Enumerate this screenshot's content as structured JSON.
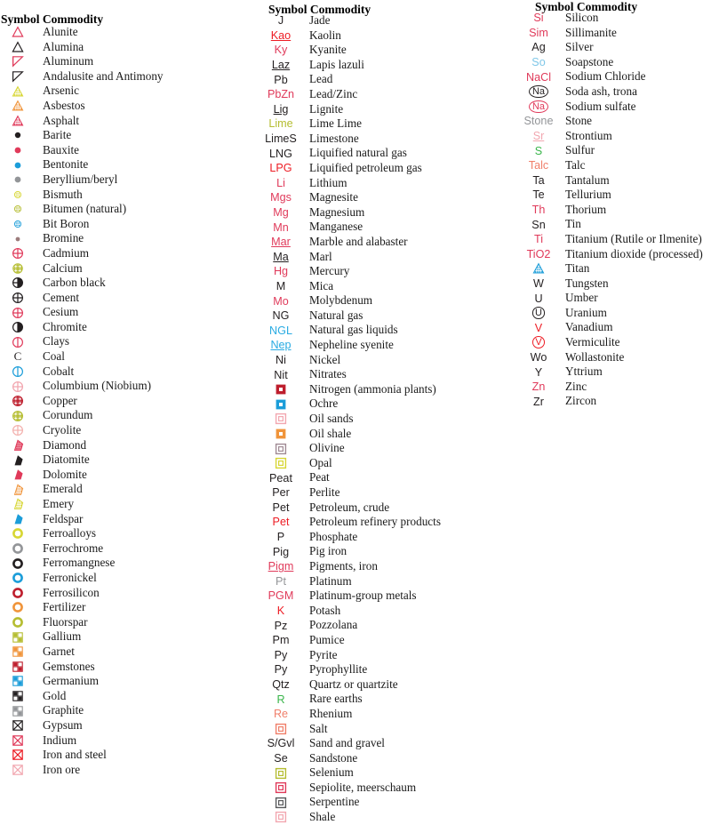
{
  "headers": {
    "symbol": "Symbol",
    "commodity": "Commodity",
    "full": "Symbol Commodity"
  },
  "colors": {
    "black": "#231f20",
    "crimson": "#e03a5a",
    "red": "#ed1c24",
    "blue": "#1b9dd9",
    "cyan": "#29abe2",
    "gray": "#939598",
    "yellow": "#d7d633",
    "olive": "#b5bd31",
    "orange": "#f0943a",
    "pink": "#f2a7b0",
    "darkred": "#be1e2d",
    "green": "#39b54a",
    "salmon": "#f07f6a",
    "tan": "#d9a066",
    "lightblue": "#7fc7e8"
  },
  "columns": [
    {
      "id": "column-1",
      "rows": [
        {
          "symbol": "triangle-outline-crimson",
          "label": "Alunite"
        },
        {
          "symbol": "triangle-outline-black",
          "label": "Alumina"
        },
        {
          "symbol": "flag-triangle-crimson",
          "label": "Aluminum"
        },
        {
          "symbol": "flag-triangle-black",
          "label": "Andalusite and Antimony"
        },
        {
          "symbol": "triangle-dotted-yellow",
          "label": "Arsenic"
        },
        {
          "symbol": "triangle-dotted-orange",
          "label": "Asbestos"
        },
        {
          "symbol": "triangle-dotted-crimson",
          "label": "Asphalt"
        },
        {
          "symbol": "dot-black",
          "label": "Barite"
        },
        {
          "symbol": "dot-crimson",
          "label": "Bauxite"
        },
        {
          "symbol": "dot-blue",
          "label": "Bentonite"
        },
        {
          "symbol": "dot-gray",
          "label": "Beryllium/beryl"
        },
        {
          "symbol": "dot-dotted-yellow",
          "label": "Bismuth"
        },
        {
          "symbol": "dot-dotted-olive",
          "label": "Bitumen (natural)"
        },
        {
          "symbol": "dot-dotted-blue",
          "label": "Bit Boron"
        },
        {
          "symbol": "dot-small-mauve",
          "label": "Bromine"
        },
        {
          "symbol": "circle-cross-crimson",
          "label": "Cadmium"
        },
        {
          "symbol": "circle-cross-dotted-olive",
          "label": "Calcium"
        },
        {
          "symbol": "circle-half-black",
          "label": "Carbon black"
        },
        {
          "symbol": "circle-cross-black",
          "label": "Cement"
        },
        {
          "symbol": "circle-cross-crimson2",
          "label": "Cesium"
        },
        {
          "symbol": "circle-vhalf-black",
          "label": "Chromite"
        },
        {
          "symbol": "circle-vhalf-crimson",
          "label": "Clays"
        },
        {
          "symbol": "letter-C",
          "label": "Coal"
        },
        {
          "symbol": "circle-vhalf-blue",
          "label": "Cobalt"
        },
        {
          "symbol": "circle-cross-pink",
          "label": "Columbium (Niobium)"
        },
        {
          "symbol": "circle-cross-darkred",
          "label": "Copper"
        },
        {
          "symbol": "circle-cross-olive",
          "label": "Corundum"
        },
        {
          "symbol": "circle-cross-pink2",
          "label": "Cryolite"
        },
        {
          "symbol": "pentagon-dotted-crimson",
          "label": "Diamond"
        },
        {
          "symbol": "pentagon-black",
          "label": "Diatomite"
        },
        {
          "symbol": "pentagon-crimson",
          "label": "Dolomite"
        },
        {
          "symbol": "pentagon-dotted-orange",
          "label": "Emerald"
        },
        {
          "symbol": "pentagon-dotted-yellow",
          "label": "Emery"
        },
        {
          "symbol": "pentagon-blue",
          "label": "Feldspar"
        },
        {
          "symbol": "donut-yellow",
          "label": "Ferroalloys"
        },
        {
          "symbol": "donut-gray",
          "label": "Ferrochrome"
        },
        {
          "symbol": "donut-black",
          "label": "Ferromangnese"
        },
        {
          "symbol": "donut-blue",
          "label": "Ferronickel"
        },
        {
          "symbol": "donut-crimson",
          "label": "Ferrosilicon"
        },
        {
          "symbol": "donut-orange",
          "label": "Fertilizer"
        },
        {
          "symbol": "donut-olive",
          "label": "Fluorspar"
        },
        {
          "symbol": "quad-square-olive",
          "label": "Gallium"
        },
        {
          "symbol": "quad-square-orange",
          "label": "Garnet"
        },
        {
          "symbol": "quad-square-crimson",
          "label": "Gemstones"
        },
        {
          "symbol": "quad-square-blue",
          "label": "Germanium"
        },
        {
          "symbol": "quad-square-black",
          "label": "Gold"
        },
        {
          "symbol": "quad-square-gray",
          "label": "Graphite"
        },
        {
          "symbol": "xsquare-black",
          "label": "Gypsum"
        },
        {
          "symbol": "xsquare-crimson",
          "label": "Indium"
        },
        {
          "symbol": "xsquare-red",
          "label": "Iron and steel"
        },
        {
          "symbol": "xsquare-pink",
          "label": "Iron ore"
        }
      ]
    },
    {
      "id": "column-2",
      "rows": [
        {
          "symbol": "text",
          "text": "J",
          "color": "black",
          "label": "Jade"
        },
        {
          "symbol": "text",
          "text": "Kao",
          "color": "red",
          "underline": true,
          "label": "Kaolin"
        },
        {
          "symbol": "text",
          "text": "Ky",
          "color": "crimson",
          "label": "Kyanite"
        },
        {
          "symbol": "text",
          "text": "Laz",
          "color": "black",
          "underline": true,
          "label": "Lapis lazuli"
        },
        {
          "symbol": "text",
          "text": "Pb",
          "color": "black",
          "label": "Lead"
        },
        {
          "symbol": "text",
          "text": "PbZn",
          "color": "crimson",
          "label": "Lead/Zinc"
        },
        {
          "symbol": "text",
          "text": "Lig",
          "color": "black",
          "underline": true,
          "label": "Lignite"
        },
        {
          "symbol": "text",
          "text": "Lime",
          "color": "olive",
          "label": "Lime Lime"
        },
        {
          "symbol": "text",
          "text": "LimeS",
          "color": "black",
          "label": "Limestone"
        },
        {
          "symbol": "text",
          "text": "LNG",
          "color": "black",
          "label": "Liquified natural gas"
        },
        {
          "symbol": "text",
          "text": "LPG",
          "color": "red",
          "label": "Liquified petroleum gas"
        },
        {
          "symbol": "text",
          "text": "Li",
          "color": "crimson",
          "label": "Lithium"
        },
        {
          "symbol": "text",
          "text": "Mgs",
          "color": "crimson",
          "label": "Magnesite"
        },
        {
          "symbol": "text",
          "text": "Mg",
          "color": "crimson",
          "label": "Magnesium"
        },
        {
          "symbol": "text",
          "text": "Mn",
          "color": "crimson",
          "label": "Manganese"
        },
        {
          "symbol": "text",
          "text": "Mar",
          "color": "crimson",
          "underline": true,
          "label": "Marble and alabaster"
        },
        {
          "symbol": "text",
          "text": "Ma",
          "color": "black",
          "underline": true,
          "label": "Marl"
        },
        {
          "symbol": "text",
          "text": "Hg",
          "color": "crimson",
          "label": "Mercury"
        },
        {
          "symbol": "text",
          "text": "M",
          "color": "black",
          "label": "Mica"
        },
        {
          "symbol": "text",
          "text": "Mo",
          "color": "crimson",
          "label": "Molybdenum"
        },
        {
          "symbol": "text",
          "text": "NG",
          "color": "black",
          "label": "Natural gas"
        },
        {
          "symbol": "text",
          "text": "NGL",
          "color": "cyan",
          "label": "Natural gas liquids"
        },
        {
          "symbol": "text",
          "text": "Nep",
          "color": "cyan",
          "underline": true,
          "label": "Nepheline syenite"
        },
        {
          "symbol": "text",
          "text": "Ni",
          "color": "black",
          "label": "Nickel"
        },
        {
          "symbol": "text",
          "text": "Nit",
          "color": "black",
          "label": "Nitrates"
        },
        {
          "symbol": "box-inner-darkred",
          "label": "Nitrogen (ammonia plants)"
        },
        {
          "symbol": "box-inner-blue",
          "label": "Ochre"
        },
        {
          "symbol": "box-inner-pink",
          "label": "Oil sands"
        },
        {
          "symbol": "box-inner-orange",
          "label": "Oil shale"
        },
        {
          "symbol": "box-inner-mauve",
          "label": "Olivine"
        },
        {
          "symbol": "box-inner-yellow",
          "label": "Opal"
        },
        {
          "symbol": "text",
          "text": "Peat",
          "color": "black",
          "label": "Peat"
        },
        {
          "symbol": "text",
          "text": "Per",
          "color": "black",
          "label": "Perlite"
        },
        {
          "symbol": "text",
          "text": "Pet",
          "color": "black",
          "label": "Petroleum, crude"
        },
        {
          "symbol": "text",
          "text": "Pet",
          "color": "red",
          "label": "Petroleum refinery products"
        },
        {
          "symbol": "text",
          "text": "P",
          "color": "black",
          "label": "Phosphate"
        },
        {
          "symbol": "text",
          "text": "Pig",
          "color": "black",
          "label": "Pig iron"
        },
        {
          "symbol": "text",
          "text": "Pigm",
          "color": "crimson",
          "underline": true,
          "label": "Pigments, iron"
        },
        {
          "symbol": "text",
          "text": "Pt",
          "color": "gray",
          "label": "Platinum"
        },
        {
          "symbol": "text",
          "text": "PGM",
          "color": "crimson",
          "label": "Platinum-group metals"
        },
        {
          "symbol": "text",
          "text": "K",
          "color": "red",
          "label": "Potash"
        },
        {
          "symbol": "text",
          "text": "Pz",
          "color": "black",
          "label": "Pozzolana"
        },
        {
          "symbol": "text",
          "text": "Pm",
          "color": "black",
          "label": "Pumice"
        },
        {
          "symbol": "text",
          "text": "Py",
          "color": "black",
          "label": "Pyrite"
        },
        {
          "symbol": "text",
          "text": "Py",
          "color": "black",
          "label": "Pyrophyllite"
        },
        {
          "symbol": "text",
          "text": "Qtz",
          "color": "black",
          "label": "Quartz or quartzite"
        },
        {
          "symbol": "text",
          "text": "R",
          "color": "green",
          "label": "Rare earths"
        },
        {
          "symbol": "text",
          "text": "Re",
          "color": "salmon",
          "label": "Rhenium"
        },
        {
          "symbol": "box-inner-salmon",
          "label": "Salt"
        },
        {
          "symbol": "text",
          "text": "S/Gvl",
          "color": "black",
          "label": "Sand and gravel"
        },
        {
          "symbol": "text",
          "text": "Se",
          "color": "black",
          "label": "Sandstone"
        },
        {
          "symbol": "box-inner-olive",
          "label": "Selenium"
        },
        {
          "symbol": "box-inner-crimson",
          "label": "Sepiolite, meerschaum"
        },
        {
          "symbol": "box-inner-black",
          "label": "Serpentine"
        },
        {
          "symbol": "box-inner-pink2",
          "label": "Shale"
        }
      ]
    },
    {
      "id": "column-3",
      "rows": [
        {
          "symbol": "text",
          "text": "Si",
          "color": "crimson",
          "label": "Silicon"
        },
        {
          "symbol": "text",
          "text": "Sim",
          "color": "crimson",
          "label": "Sillimanite"
        },
        {
          "symbol": "text",
          "text": "Ag",
          "color": "black",
          "label": "Silver"
        },
        {
          "symbol": "text",
          "text": "So",
          "color": "lightblue",
          "label": "Soapstone"
        },
        {
          "symbol": "text",
          "text": "NaCl",
          "color": "crimson",
          "label": "Sodium Chloride"
        },
        {
          "symbol": "circled",
          "text": "Na",
          "color": "black",
          "label": "Soda ash, trona"
        },
        {
          "symbol": "circled",
          "text": "Na",
          "color": "crimson",
          "label": "Sodium sulfate"
        },
        {
          "symbol": "text",
          "text": "Stone",
          "color": "gray",
          "label": "Stone"
        },
        {
          "symbol": "text",
          "text": "Sr",
          "color": "pink",
          "underline": true,
          "label": "Strontium"
        },
        {
          "symbol": "text",
          "text": "S",
          "color": "green",
          "label": "Sulfur"
        },
        {
          "symbol": "text",
          "text": "Talc",
          "color": "salmon",
          "label": "Talc"
        },
        {
          "symbol": "text",
          "text": "Ta",
          "color": "black",
          "label": "Tantalum"
        },
        {
          "symbol": "text",
          "text": "Te",
          "color": "black",
          "label": "Tellurium"
        },
        {
          "symbol": "text",
          "text": "Th",
          "color": "crimson",
          "label": "Thorium"
        },
        {
          "symbol": "text",
          "text": "Sn",
          "color": "black",
          "label": "Tin"
        },
        {
          "symbol": "text",
          "text": "Ti",
          "color": "crimson",
          "label": "Titanium (Rutile or Ilmenite)"
        },
        {
          "symbol": "text",
          "text": "TiO2",
          "color": "crimson",
          "label": "Titanium dioxide (processed)"
        },
        {
          "symbol": "triangle-dotted-blue",
          "label": "Titan"
        },
        {
          "symbol": "text",
          "text": "W",
          "color": "black",
          "label": "Tungsten"
        },
        {
          "symbol": "text",
          "text": "U",
          "color": "black",
          "label": "Umber"
        },
        {
          "symbol": "circled",
          "text": "U",
          "color": "black",
          "label": "Uranium"
        },
        {
          "symbol": "text",
          "text": "V",
          "color": "red",
          "label": "Vanadium"
        },
        {
          "symbol": "circled",
          "text": "V",
          "color": "red",
          "label": "Vermiculite"
        },
        {
          "symbol": "text",
          "text": "Wo",
          "color": "black",
          "label": "Wollastonite"
        },
        {
          "symbol": "text",
          "text": "Y",
          "color": "black",
          "label": "Yttrium"
        },
        {
          "symbol": "text",
          "text": "Zn",
          "color": "crimson",
          "label": "Zinc"
        },
        {
          "symbol": "text",
          "text": "Zr",
          "color": "black",
          "label": "Zircon"
        }
      ]
    }
  ]
}
